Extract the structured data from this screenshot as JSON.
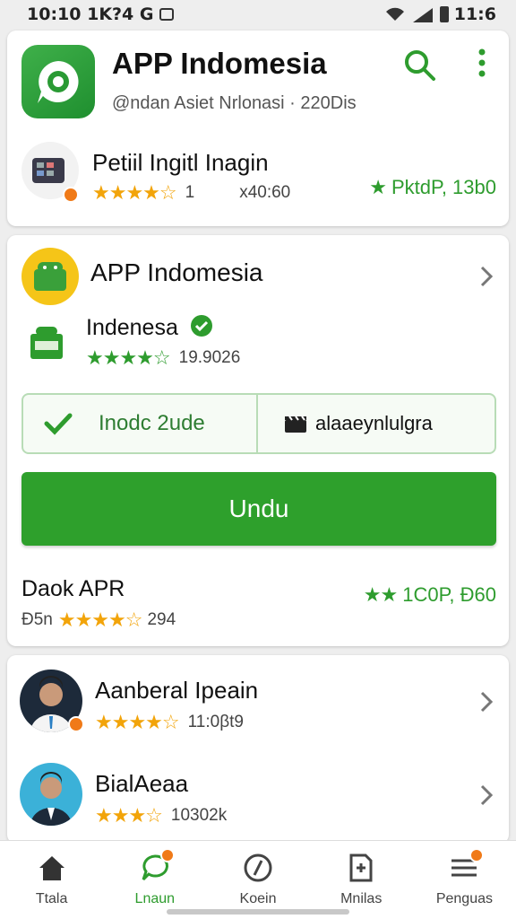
{
  "status_bar": {
    "time_left": "10:10 1K?4 G",
    "time_right": "11:6"
  },
  "app": {
    "title": "APP Indomesia",
    "subtitle": "@ndan Asiet Nrlonasi · 220Dis"
  },
  "card1": {
    "item": {
      "title": "Petiil Ingitl Inagin",
      "rating_count": "1",
      "downloads": "x40:60",
      "tag": "PktdP, 13b0"
    }
  },
  "card2": {
    "header": {
      "title": "APP Indomesia"
    },
    "sub": {
      "title": "Indenesa",
      "rating": "19.9026"
    },
    "segment": {
      "left_label": "Inodc 2ude",
      "right_label": "alaaeynlulgra"
    },
    "button_label": "Undu",
    "footer": {
      "title": "Daok APR",
      "prefix": "Ð5n",
      "rating": "294",
      "tag": "1C0P, Ð60"
    }
  },
  "card3": {
    "items": [
      {
        "title": "Aanberal Ipeain",
        "rating": "11:0βt9"
      },
      {
        "title": "BialAeaa",
        "rating": "10302k"
      }
    ]
  },
  "nav": [
    {
      "label": "Ttala",
      "icon": "home-icon"
    },
    {
      "label": "Lnaun",
      "icon": "chat-icon"
    },
    {
      "label": "Koein",
      "icon": "compass-icon"
    },
    {
      "label": "Mnilas",
      "icon": "document-icon"
    },
    {
      "label": "Penguas",
      "icon": "menu-icon"
    }
  ],
  "colors": {
    "brand_green": "#2ea02c",
    "star_orange": "#f2a40a",
    "badge_orange": "#f07a18"
  }
}
